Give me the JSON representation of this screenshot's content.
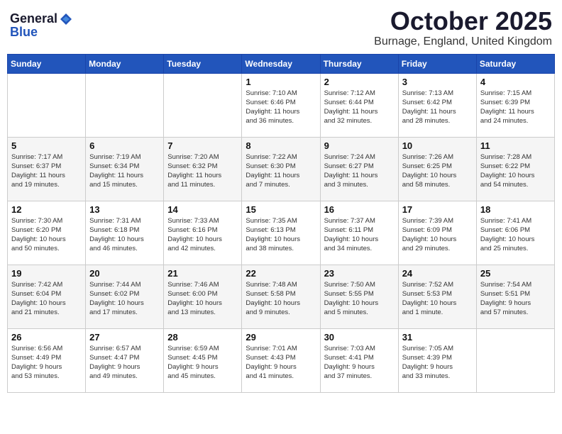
{
  "header": {
    "logo_general": "General",
    "logo_blue": "Blue",
    "month_title": "October 2025",
    "location": "Burnage, England, United Kingdom"
  },
  "days_of_week": [
    "Sunday",
    "Monday",
    "Tuesday",
    "Wednesday",
    "Thursday",
    "Friday",
    "Saturday"
  ],
  "weeks": [
    [
      {
        "day": "",
        "info": ""
      },
      {
        "day": "",
        "info": ""
      },
      {
        "day": "",
        "info": ""
      },
      {
        "day": "1",
        "info": "Sunrise: 7:10 AM\nSunset: 6:46 PM\nDaylight: 11 hours\nand 36 minutes."
      },
      {
        "day": "2",
        "info": "Sunrise: 7:12 AM\nSunset: 6:44 PM\nDaylight: 11 hours\nand 32 minutes."
      },
      {
        "day": "3",
        "info": "Sunrise: 7:13 AM\nSunset: 6:42 PM\nDaylight: 11 hours\nand 28 minutes."
      },
      {
        "day": "4",
        "info": "Sunrise: 7:15 AM\nSunset: 6:39 PM\nDaylight: 11 hours\nand 24 minutes."
      }
    ],
    [
      {
        "day": "5",
        "info": "Sunrise: 7:17 AM\nSunset: 6:37 PM\nDaylight: 11 hours\nand 19 minutes."
      },
      {
        "day": "6",
        "info": "Sunrise: 7:19 AM\nSunset: 6:34 PM\nDaylight: 11 hours\nand 15 minutes."
      },
      {
        "day": "7",
        "info": "Sunrise: 7:20 AM\nSunset: 6:32 PM\nDaylight: 11 hours\nand 11 minutes."
      },
      {
        "day": "8",
        "info": "Sunrise: 7:22 AM\nSunset: 6:30 PM\nDaylight: 11 hours\nand 7 minutes."
      },
      {
        "day": "9",
        "info": "Sunrise: 7:24 AM\nSunset: 6:27 PM\nDaylight: 11 hours\nand 3 minutes."
      },
      {
        "day": "10",
        "info": "Sunrise: 7:26 AM\nSunset: 6:25 PM\nDaylight: 10 hours\nand 58 minutes."
      },
      {
        "day": "11",
        "info": "Sunrise: 7:28 AM\nSunset: 6:22 PM\nDaylight: 10 hours\nand 54 minutes."
      }
    ],
    [
      {
        "day": "12",
        "info": "Sunrise: 7:30 AM\nSunset: 6:20 PM\nDaylight: 10 hours\nand 50 minutes."
      },
      {
        "day": "13",
        "info": "Sunrise: 7:31 AM\nSunset: 6:18 PM\nDaylight: 10 hours\nand 46 minutes."
      },
      {
        "day": "14",
        "info": "Sunrise: 7:33 AM\nSunset: 6:16 PM\nDaylight: 10 hours\nand 42 minutes."
      },
      {
        "day": "15",
        "info": "Sunrise: 7:35 AM\nSunset: 6:13 PM\nDaylight: 10 hours\nand 38 minutes."
      },
      {
        "day": "16",
        "info": "Sunrise: 7:37 AM\nSunset: 6:11 PM\nDaylight: 10 hours\nand 34 minutes."
      },
      {
        "day": "17",
        "info": "Sunrise: 7:39 AM\nSunset: 6:09 PM\nDaylight: 10 hours\nand 29 minutes."
      },
      {
        "day": "18",
        "info": "Sunrise: 7:41 AM\nSunset: 6:06 PM\nDaylight: 10 hours\nand 25 minutes."
      }
    ],
    [
      {
        "day": "19",
        "info": "Sunrise: 7:42 AM\nSunset: 6:04 PM\nDaylight: 10 hours\nand 21 minutes."
      },
      {
        "day": "20",
        "info": "Sunrise: 7:44 AM\nSunset: 6:02 PM\nDaylight: 10 hours\nand 17 minutes."
      },
      {
        "day": "21",
        "info": "Sunrise: 7:46 AM\nSunset: 6:00 PM\nDaylight: 10 hours\nand 13 minutes."
      },
      {
        "day": "22",
        "info": "Sunrise: 7:48 AM\nSunset: 5:58 PM\nDaylight: 10 hours\nand 9 minutes."
      },
      {
        "day": "23",
        "info": "Sunrise: 7:50 AM\nSunset: 5:55 PM\nDaylight: 10 hours\nand 5 minutes."
      },
      {
        "day": "24",
        "info": "Sunrise: 7:52 AM\nSunset: 5:53 PM\nDaylight: 10 hours\nand 1 minute."
      },
      {
        "day": "25",
        "info": "Sunrise: 7:54 AM\nSunset: 5:51 PM\nDaylight: 9 hours\nand 57 minutes."
      }
    ],
    [
      {
        "day": "26",
        "info": "Sunrise: 6:56 AM\nSunset: 4:49 PM\nDaylight: 9 hours\nand 53 minutes."
      },
      {
        "day": "27",
        "info": "Sunrise: 6:57 AM\nSunset: 4:47 PM\nDaylight: 9 hours\nand 49 minutes."
      },
      {
        "day": "28",
        "info": "Sunrise: 6:59 AM\nSunset: 4:45 PM\nDaylight: 9 hours\nand 45 minutes."
      },
      {
        "day": "29",
        "info": "Sunrise: 7:01 AM\nSunset: 4:43 PM\nDaylight: 9 hours\nand 41 minutes."
      },
      {
        "day": "30",
        "info": "Sunrise: 7:03 AM\nSunset: 4:41 PM\nDaylight: 9 hours\nand 37 minutes."
      },
      {
        "day": "31",
        "info": "Sunrise: 7:05 AM\nSunset: 4:39 PM\nDaylight: 9 hours\nand 33 minutes."
      },
      {
        "day": "",
        "info": ""
      }
    ]
  ]
}
